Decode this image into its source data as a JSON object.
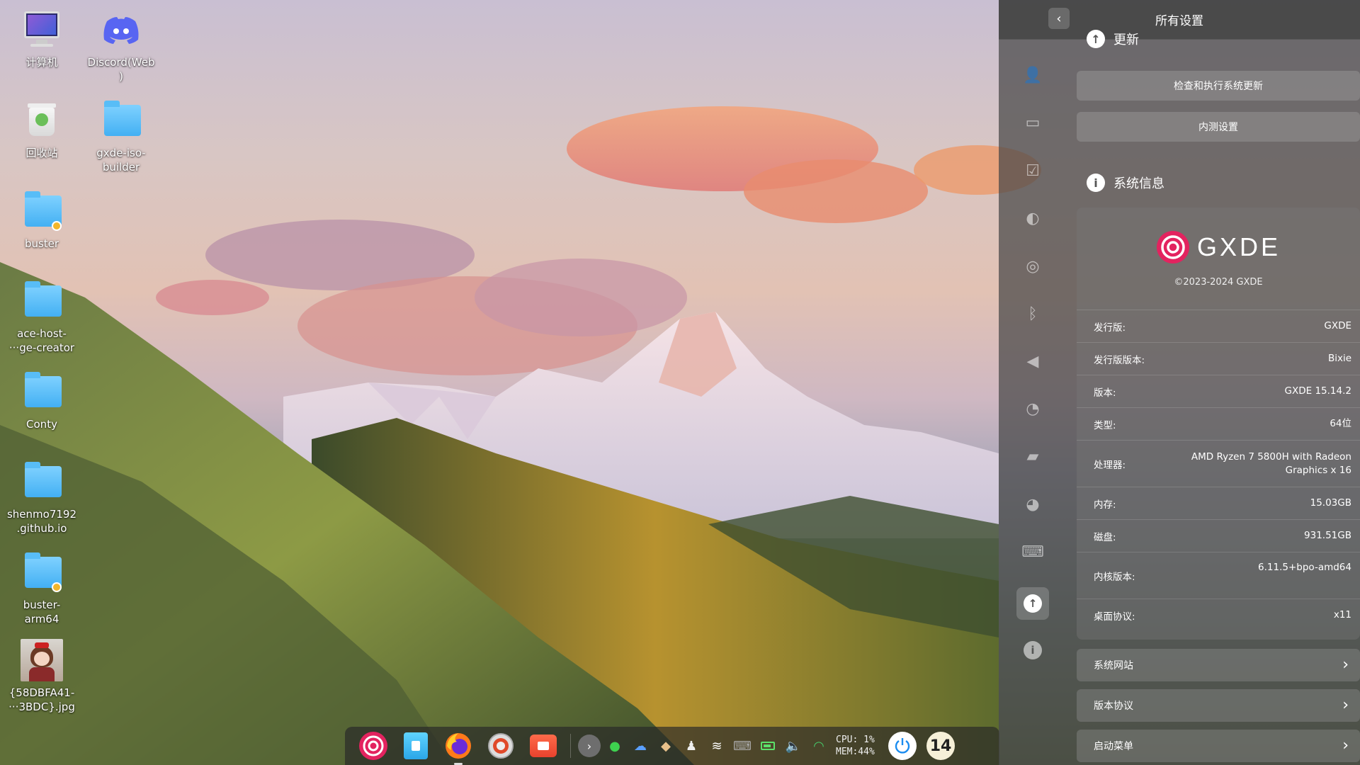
{
  "desktop": {
    "icons": [
      {
        "label": "计算机"
      },
      {
        "label": "Discord(Web\n)"
      },
      {
        "label": "回收站"
      },
      {
        "label": "gxde-iso-\nbuilder"
      },
      {
        "label": "buster"
      },
      {
        "label": "ace-host-\n···ge-creator"
      },
      {
        "label": "Conty"
      },
      {
        "label": "shenmo7192\n.github.io"
      },
      {
        "label": "buster-\narm64"
      },
      {
        "label": "{58DBFA41-\n···3BDC}.jpg"
      }
    ]
  },
  "dock": {
    "apps": [
      "gxde-launcher-icon",
      "file-manager-icon",
      "firefox-icon",
      "settings-gear-icon",
      "screen-recorder-icon"
    ],
    "tray": [
      "wechat-icon",
      "network-drive-icon",
      "cat-icon",
      "qq-penguin-icon",
      "wifi-icon",
      "keyboard-icon",
      "battery-icon",
      "volume-icon",
      "clipboard-icon"
    ],
    "cpu_line": "CPU: 1%",
    "mem_line": "MEM:44%",
    "clock_text": "14"
  },
  "settings": {
    "title": "所有设置",
    "update_heading": "更新",
    "update_button": "检查和执行系统更新",
    "beta_button": "内测设置",
    "sysinfo_heading": "系统信息",
    "logo_text": "GXDE",
    "copyright": "©2023-2024 GXDE",
    "rows": [
      {
        "key": "发行版:",
        "value": "GXDE"
      },
      {
        "key": "发行版版本:",
        "value": "Bixie"
      },
      {
        "key": "版本:",
        "value": "GXDE 15.14.2"
      },
      {
        "key": "类型:",
        "value": "64位"
      },
      {
        "key": "处理器:",
        "value": "AMD Ryzen 7 5800H with Radeon Graphics x 16"
      },
      {
        "key": "内存:",
        "value": "15.03GB"
      },
      {
        "key": "磁盘:",
        "value": "931.51GB"
      },
      {
        "key": "内核版本:",
        "value": "6.11.5+bpo-amd64"
      },
      {
        "key": "桌面协议:",
        "value": "x11"
      }
    ],
    "links": [
      {
        "label": "系统网站"
      },
      {
        "label": "版本协议"
      },
      {
        "label": "启动菜单"
      }
    ],
    "nav_icons": [
      "account-icon",
      "display-icon",
      "default-apps-icon",
      "personalization-icon",
      "network-icon",
      "bluetooth-icon",
      "sound-icon",
      "datetime-icon",
      "power-icon",
      "mouse-icon",
      "keyboard-icon",
      "update-icon",
      "info-icon"
    ]
  }
}
